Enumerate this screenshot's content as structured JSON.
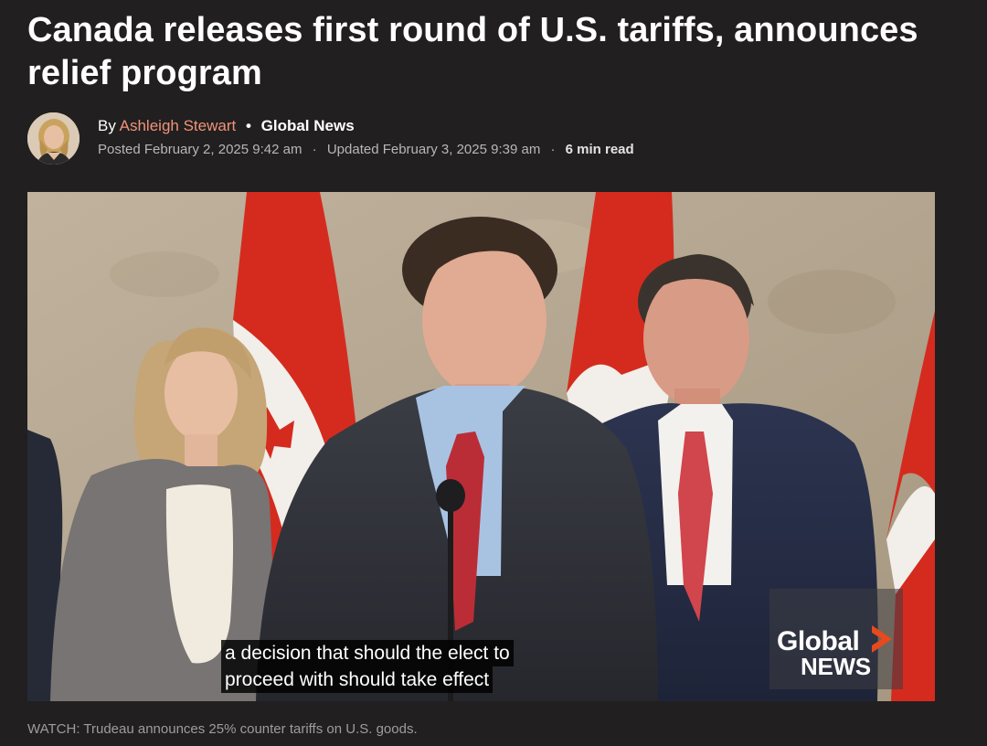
{
  "article": {
    "headline": "Canada releases first round of U.S. tariffs, announces relief program",
    "byline": {
      "by": "By",
      "author": "Ashleigh Stewart",
      "outlet": "Global News",
      "posted": "Posted February 2, 2025 9:42 am",
      "updated": "Updated February 3, 2025 9:39 am",
      "read_time": "6 min read"
    }
  },
  "video": {
    "caption_line1": "a decision that should the elect to",
    "caption_line2": "proceed with should take effect",
    "logo_line1": "Global",
    "logo_line2": "NEWS",
    "watch_caption": "WATCH: Trudeau announces 25% counter tariffs on U.S. goods."
  },
  "colors": {
    "background": "#211f20",
    "author_link": "#f0937a",
    "flag_red": "#d52b1e",
    "logo_accent": "#e8491d"
  }
}
